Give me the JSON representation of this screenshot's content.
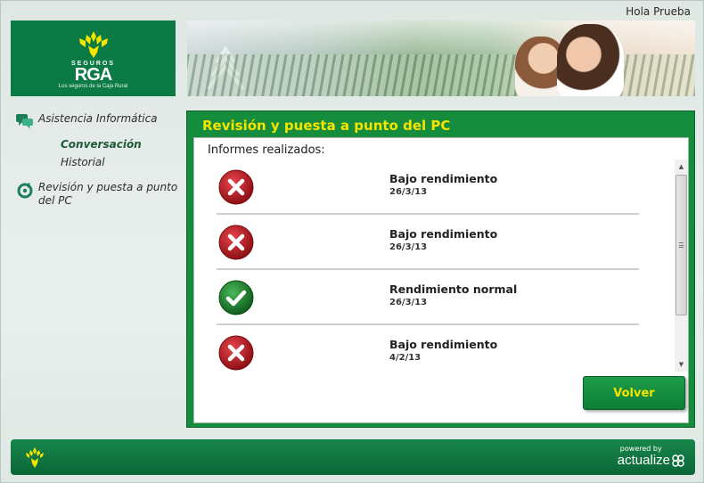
{
  "header": {
    "greeting": "Hola Prueba",
    "logo": {
      "small_text": "SEGUROS",
      "big_text": "RGA",
      "tagline": "Los seguros de la Caja Rural"
    }
  },
  "sidebar": {
    "items": [
      {
        "label": "Asistencia Informática",
        "icon": "chat-bubbles-icon",
        "children": [
          {
            "label": "Conversación",
            "active": true
          },
          {
            "label": "Historial",
            "active": false
          }
        ]
      },
      {
        "label": "Revisión y puesta a punto del PC",
        "icon": "gauge-refresh-icon"
      }
    ]
  },
  "panel": {
    "title": "Revisión y puesta a punto del PC",
    "list_caption": "Informes realizados:",
    "reports": [
      {
        "status": "error",
        "icon": "red-x-icon",
        "title": "Bajo rendimiento",
        "date": "26/3/13"
      },
      {
        "status": "error",
        "icon": "red-x-icon",
        "title": "Bajo rendimiento",
        "date": "26/3/13"
      },
      {
        "status": "ok",
        "icon": "green-check-icon",
        "title": "Rendimiento normal",
        "date": "26/3/13"
      },
      {
        "status": "error",
        "icon": "red-x-icon",
        "title": "Bajo rendimiento",
        "date": "4/2/13"
      }
    ],
    "back_label": "Volver"
  },
  "footer": {
    "powered_by": "powered by",
    "brand": "actualize"
  },
  "colors": {
    "brand_green": "#0b7a45",
    "panel_green": "#168c3d",
    "title_yellow": "#f4e400",
    "error_red": "#c0191f",
    "ok_green": "#1e8a2c"
  }
}
